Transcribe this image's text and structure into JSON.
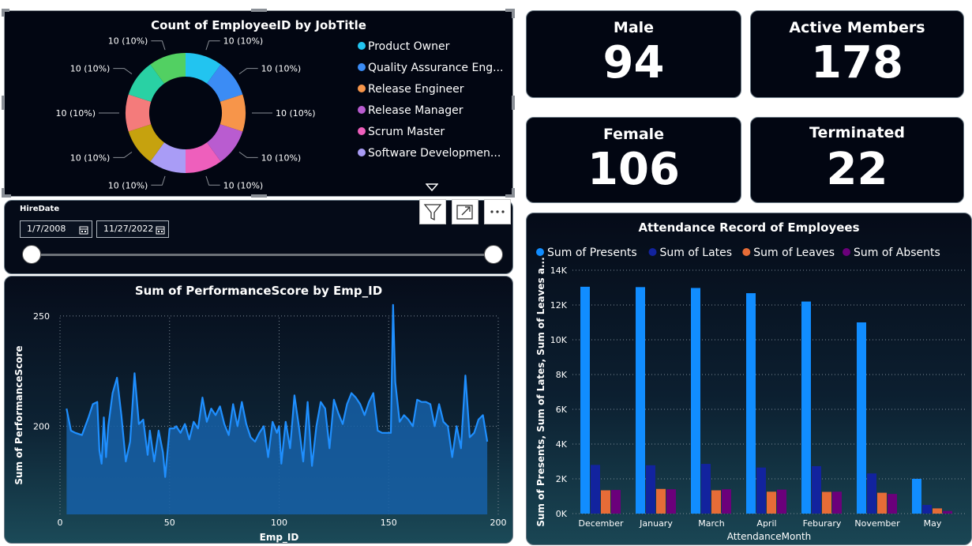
{
  "donut": {
    "title": "Count of EmployeeID by JobTitle",
    "slices": [
      {
        "label": "10 (10%)",
        "color": "#22c4f0"
      },
      {
        "label": "10 (10%)",
        "color": "#3b8cf5"
      },
      {
        "label": "10 (10%)",
        "color": "#f7954a"
      },
      {
        "label": "10 (10%)",
        "color": "#b95cd0"
      },
      {
        "label": "10 (10%)",
        "color": "#ee5fbc"
      },
      {
        "label": "10 (10%)",
        "color": "#a99cf6"
      },
      {
        "label": "10 (10%)",
        "color": "#c6a20e"
      },
      {
        "label": "10 (10%)",
        "color": "#f47b7b"
      },
      {
        "label": "10 (10%)",
        "color": "#29d1a4"
      },
      {
        "label": "10 (10%)",
        "color": "#52d062"
      }
    ],
    "legend": [
      {
        "label": "Product Owner",
        "color": "#22c4f0"
      },
      {
        "label": "Quality Assurance Eng...",
        "color": "#3b8cf5"
      },
      {
        "label": "Release Engineer",
        "color": "#f7954a"
      },
      {
        "label": "Release Manager",
        "color": "#b95cd0"
      },
      {
        "label": "Scrum Master",
        "color": "#ee5fbc"
      },
      {
        "label": "Software Developmen...",
        "color": "#a99cf6"
      }
    ]
  },
  "cards": {
    "male": {
      "title": "Male",
      "value": "94"
    },
    "active": {
      "title": "Active Members",
      "value": "178"
    },
    "female": {
      "title": "Female",
      "value": "106"
    },
    "terminated": {
      "title": "Terminated",
      "value": "22"
    }
  },
  "slicer": {
    "label": "HireDate",
    "start": "1/7/2008",
    "end": "11/27/2022"
  },
  "icons": {
    "filter": "filter-icon",
    "focus": "focus-mode-icon",
    "more": "more-options-icon",
    "calendar": "calendar-icon",
    "scroll": "scroll-down-arrow-icon"
  },
  "chart_data": [
    {
      "type": "area",
      "title": "Sum of PerformanceScore by Emp_ID",
      "xlabel": "Emp_ID",
      "ylabel": "Sum of PerformanceScore",
      "xlim": [
        0,
        200
      ],
      "ylim": [
        160,
        260
      ],
      "xticks": [
        "0",
        "50",
        "100",
        "150",
        "200"
      ],
      "yticks": [
        "200",
        "250"
      ],
      "color": "#1f8fff",
      "grid": true,
      "x": [
        3,
        5,
        7,
        10,
        13,
        15,
        17,
        18,
        19,
        20,
        21,
        22,
        24,
        26,
        28,
        30,
        32,
        34,
        36,
        38,
        40,
        41,
        43,
        45,
        47,
        48,
        50,
        52,
        53,
        55,
        57,
        59,
        61,
        63,
        65,
        67,
        69,
        71,
        73,
        75,
        77,
        79,
        81,
        83,
        85,
        87,
        89,
        91,
        93,
        95,
        97,
        99,
        100,
        101,
        103,
        105,
        107,
        109,
        111,
        113,
        115,
        117,
        119,
        121,
        123,
        125,
        127,
        129,
        131,
        133,
        135,
        137,
        139,
        141,
        143,
        145,
        147,
        149,
        151,
        152,
        153,
        155,
        157,
        159,
        161,
        163,
        165,
        167,
        169,
        171,
        173,
        175,
        177,
        179,
        181,
        183,
        185,
        187,
        189,
        191,
        193,
        195
      ],
      "y": [
        208,
        198,
        197,
        196,
        204,
        210,
        211,
        189,
        183,
        204,
        186,
        200,
        215,
        222,
        205,
        184,
        193,
        224,
        201,
        203,
        187,
        198,
        184,
        198,
        188,
        177,
        199,
        199,
        200,
        197,
        201,
        194,
        202,
        199,
        213,
        202,
        208,
        205,
        209,
        201,
        196,
        210,
        200,
        211,
        201,
        195,
        193,
        197,
        200,
        186,
        202,
        197,
        200,
        183,
        202,
        190,
        214,
        200,
        184,
        211,
        182,
        200,
        211,
        208,
        190,
        212,
        206,
        201,
        210,
        215,
        213,
        210,
        205,
        211,
        215,
        198,
        197,
        197,
        197,
        255,
        220,
        202,
        205,
        203,
        200,
        212,
        211,
        211,
        210,
        200,
        210,
        202,
        200,
        186,
        200,
        190,
        223,
        195,
        197,
        203,
        205,
        193
      ],
      "area_fill": "#1660a8"
    },
    {
      "type": "bar",
      "title": "Attendance Record of Employees",
      "xlabel": "AttendanceMonth",
      "ylabel": "Sum of Presents, Sum of Lates, Sum of Leaves a...",
      "categories": [
        "December",
        "January",
        "March",
        "April",
        "Feburary",
        "November",
        "May"
      ],
      "ylim": [
        0,
        14000
      ],
      "yticks": [
        "0K",
        "2K",
        "4K",
        "6K",
        "8K",
        "10K",
        "12K",
        "14K"
      ],
      "grid": true,
      "legend_position": "top-left",
      "series": [
        {
          "name": "Sum of Presents",
          "color": "#118dff",
          "values": [
            13050,
            13030,
            12980,
            12680,
            12200,
            11000,
            2000
          ]
        },
        {
          "name": "Sum of Lates",
          "color": "#12239e",
          "values": [
            2800,
            2780,
            2860,
            2650,
            2730,
            2310,
            500
          ]
        },
        {
          "name": "Sum of Leaves",
          "color": "#e66c37",
          "values": [
            1340,
            1420,
            1340,
            1260,
            1250,
            1200,
            300
          ]
        },
        {
          "name": "Sum of Absents",
          "color": "#6b007b",
          "values": [
            1360,
            1400,
            1400,
            1380,
            1260,
            1130,
            150
          ]
        }
      ]
    }
  ]
}
